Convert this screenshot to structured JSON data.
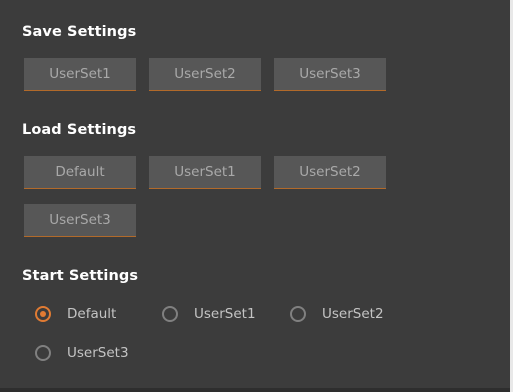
{
  "save_settings": {
    "title": "Save Settings",
    "buttons": [
      "UserSet1",
      "UserSet2",
      "UserSet3"
    ]
  },
  "load_settings": {
    "title": "Load Settings",
    "buttons": [
      "Default",
      "UserSet1",
      "UserSet2",
      "UserSet3"
    ]
  },
  "start_settings": {
    "title": "Start Settings",
    "options": [
      "Default",
      "UserSet1",
      "UserSet2",
      "UserSet3"
    ],
    "selected": "Default"
  },
  "colors": {
    "background": "#3c3c3c",
    "button": "#575757",
    "accent": "#e07b33"
  }
}
